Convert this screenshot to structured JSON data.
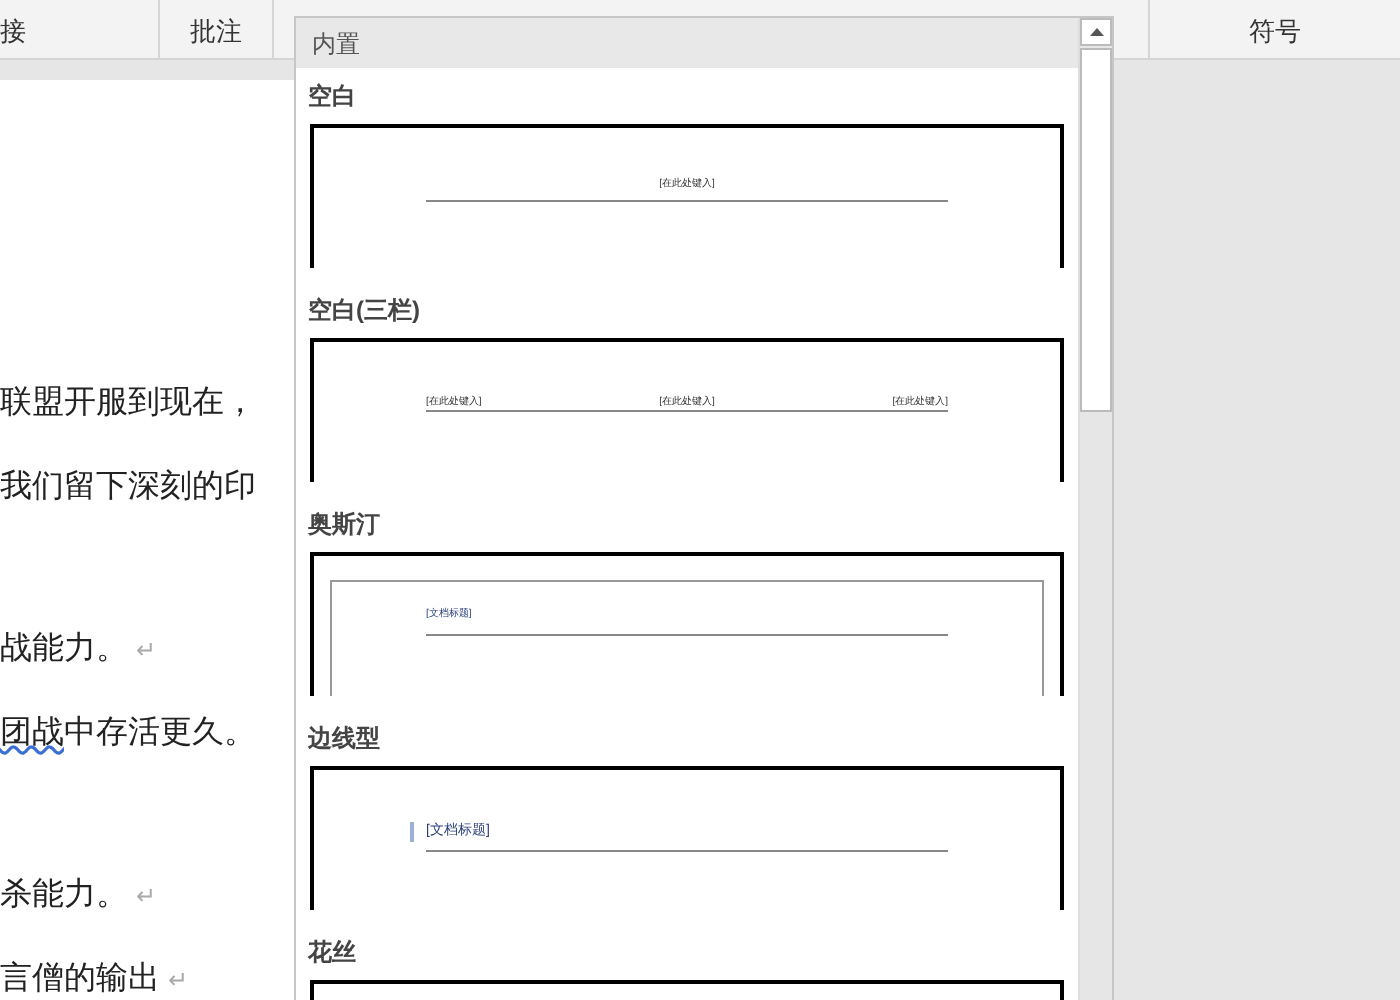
{
  "ribbon": {
    "groups": [
      {
        "label": "接"
      },
      {
        "label": "批注"
      },
      {
        "label": "符号"
      }
    ]
  },
  "document": {
    "lines": [
      {
        "segments": [
          {
            "text": "联盟开服到现在，",
            "wavy": false
          }
        ]
      },
      {
        "segments": [
          {
            "text": "我们留下深刻的印",
            "wavy": false
          }
        ]
      },
      {
        "segments": [
          {
            "text": "战能力。",
            "wavy": false
          }
        ],
        "mark": "↵"
      },
      {
        "segments": [
          {
            "text": "团战",
            "wavy": true
          },
          {
            "text": "中存活更久。",
            "wavy": false
          }
        ]
      },
      {
        "segments": [
          {
            "text": "杀能力。",
            "wavy": false
          }
        ],
        "mark": "↵"
      },
      {
        "segments": [
          {
            "text": "言僧的输出",
            "wavy": false
          }
        ],
        "mark": "↵"
      }
    ]
  },
  "gallery": {
    "header": "内置",
    "items": [
      {
        "title": "空白",
        "kind": "blank",
        "placeholders": [
          "[在此处键入]"
        ]
      },
      {
        "title": "空白(三栏)",
        "kind": "three",
        "placeholders": [
          "[在此处键入]",
          "[在此处键入]",
          "[在此处键入]"
        ]
      },
      {
        "title": "奥斯汀",
        "kind": "austin",
        "placeholders": [
          "[文档标题]"
        ]
      },
      {
        "title": "边线型",
        "kind": "sideline",
        "placeholders": [
          "[文档标题]"
        ]
      },
      {
        "title": "花丝",
        "kind": "filigree"
      }
    ]
  }
}
